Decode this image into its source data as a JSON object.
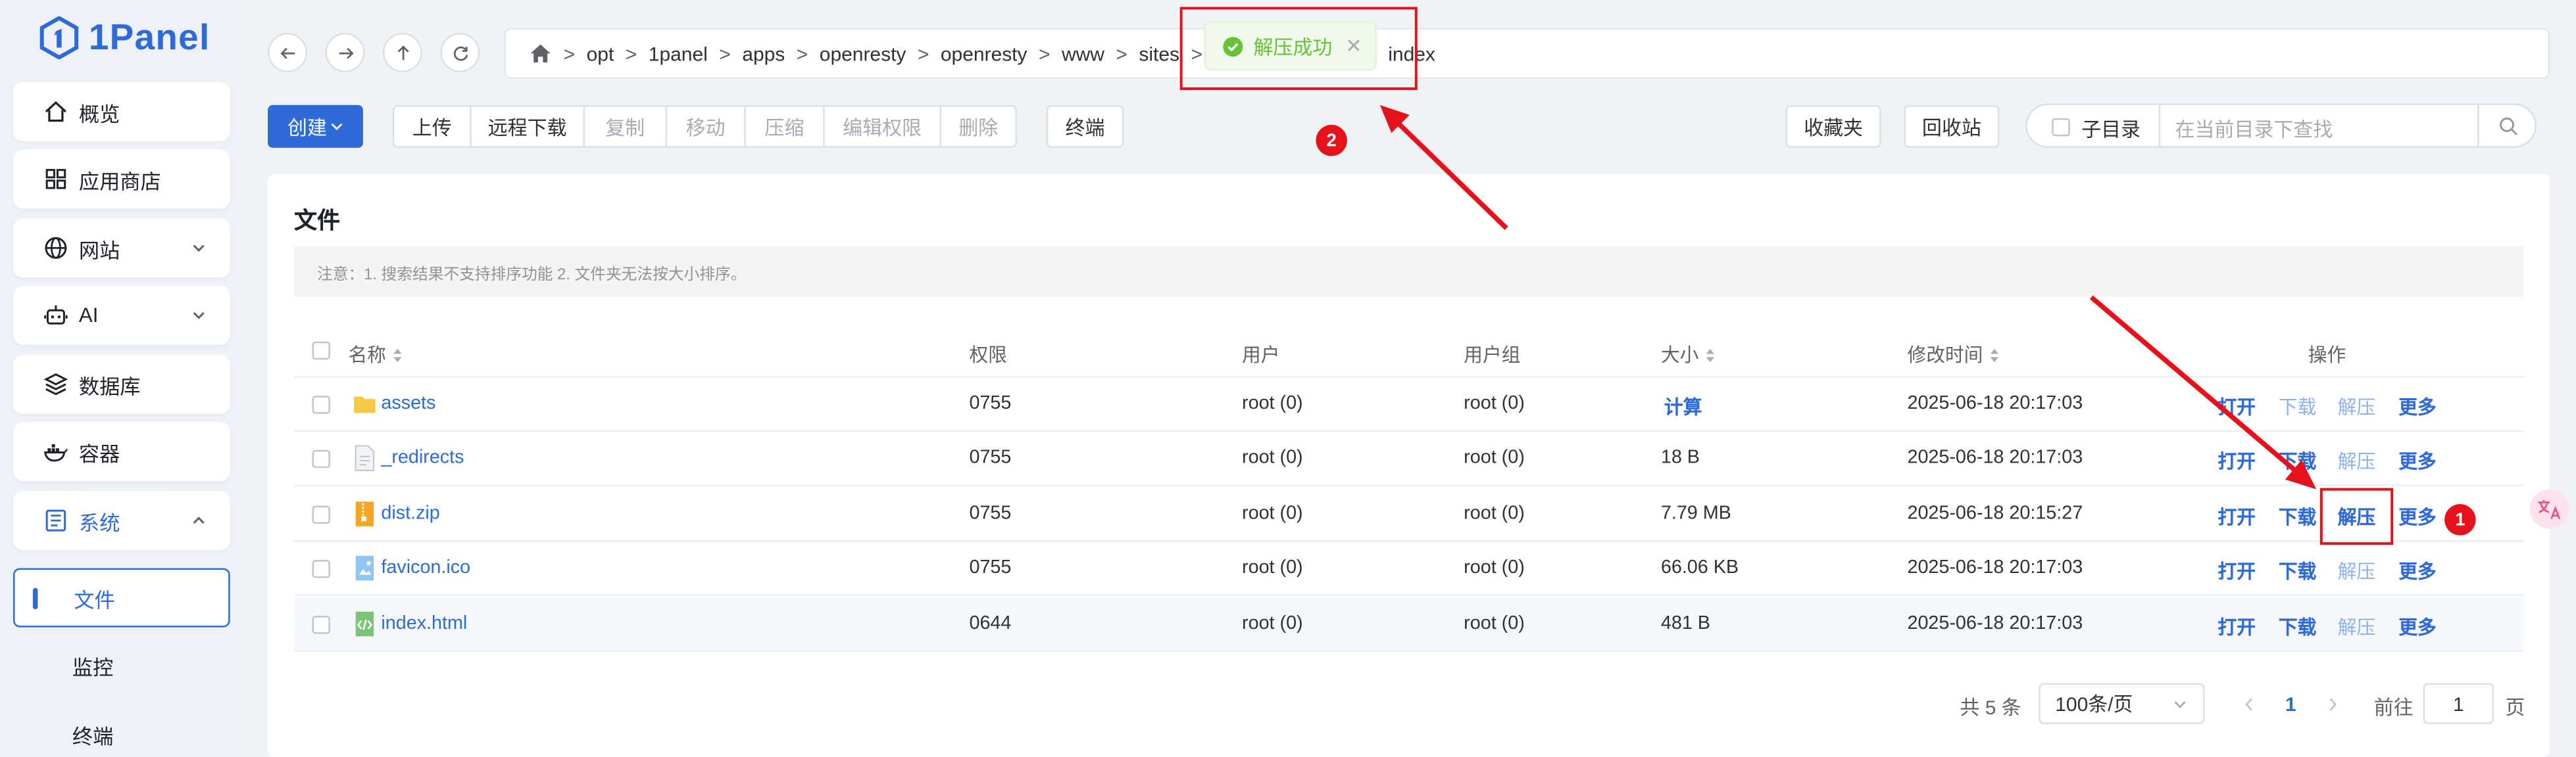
{
  "app": {
    "name": "1Panel",
    "brand_color": "#2f6bd8"
  },
  "sidebar": {
    "items": [
      {
        "label": "概览",
        "icon": "home-icon"
      },
      {
        "label": "应用商店",
        "icon": "grid-icon"
      },
      {
        "label": "网站",
        "icon": "globe-icon",
        "expandable": true
      },
      {
        "label": "AI",
        "icon": "robot-icon",
        "expandable": true
      },
      {
        "label": "数据库",
        "icon": "layers-icon"
      },
      {
        "label": "容器",
        "icon": "docker-icon"
      },
      {
        "label": "系统",
        "icon": "system-icon",
        "expanded": true
      }
    ],
    "sub_items": [
      {
        "label": "文件",
        "active": true
      },
      {
        "label": "监控"
      },
      {
        "label": "终端"
      }
    ]
  },
  "breadcrumb": {
    "segments": [
      "opt",
      "1panel",
      "apps",
      "openresty",
      "openresty",
      "www",
      "sites",
      "index"
    ],
    "separator": ">"
  },
  "toast": {
    "message": "解压成功",
    "type": "success"
  },
  "toolbar": {
    "create": "创建",
    "upload": "上传",
    "remote_download": "远程下载",
    "copy": "复制",
    "move": "移动",
    "compress": "压缩",
    "edit_permission": "编辑权限",
    "delete": "删除",
    "terminal": "终端",
    "favorites": "收藏夹",
    "recycle_bin": "回收站"
  },
  "search": {
    "subdir_label": "子目录",
    "placeholder": "在当前目录下查找"
  },
  "files": {
    "title": "文件",
    "notice": "注意：1. 搜索结果不支持排序功能 2. 文件夹无法按大小排序。",
    "columns": [
      "名称",
      "权限",
      "用户",
      "用户组",
      "大小",
      "修改时间",
      "操作"
    ],
    "rows": [
      {
        "name": "assets",
        "type": "folder",
        "perm": "0755",
        "user": "root (0)",
        "group": "root (0)",
        "size": "计算",
        "mtime": "2025-06-18 20:17:03"
      },
      {
        "name": "_redirects",
        "type": "file",
        "perm": "0755",
        "user": "root (0)",
        "group": "root (0)",
        "size": "18 B",
        "mtime": "2025-06-18 20:17:03"
      },
      {
        "name": "dist.zip",
        "type": "zip",
        "perm": "0755",
        "user": "root (0)",
        "group": "root (0)",
        "size": "7.79 MB",
        "mtime": "2025-06-18 20:15:27"
      },
      {
        "name": "favicon.ico",
        "type": "image",
        "perm": "0755",
        "user": "root (0)",
        "group": "root (0)",
        "size": "66.06 KB",
        "mtime": "2025-06-18 20:17:03"
      },
      {
        "name": "index.html",
        "type": "html",
        "perm": "0644",
        "user": "root (0)",
        "group": "root (0)",
        "size": "481 B",
        "mtime": "2025-06-18 20:17:03"
      }
    ],
    "actions": {
      "open": "打开",
      "download": "下载",
      "extract": "解压",
      "more": "更多"
    }
  },
  "pagination": {
    "total": "共 5 条",
    "page_size": "100条/页",
    "current": "1",
    "goto_label": "前往",
    "goto_value": "1",
    "page_suffix": "页"
  },
  "annotations": {
    "badge1": "1",
    "badge2": "2",
    "color": "#e5121c"
  }
}
